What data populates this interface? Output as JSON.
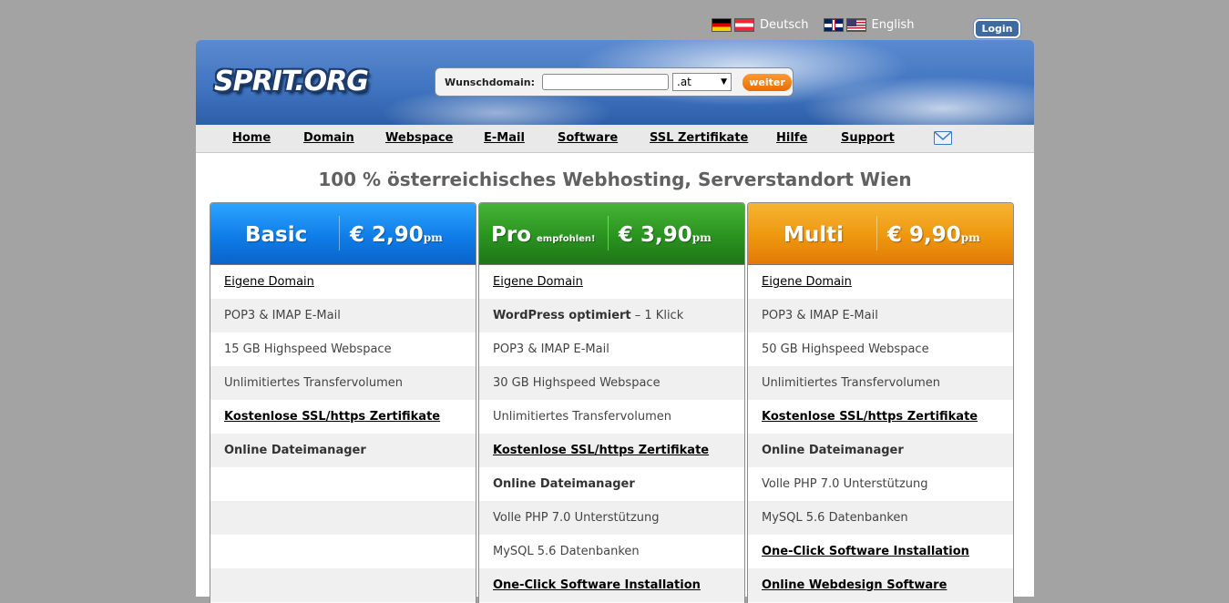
{
  "languages": [
    {
      "label": "Deutsch"
    },
    {
      "label": "English"
    }
  ],
  "login_label": "Login",
  "header": {
    "logo": "SPRIT.ORG",
    "search_label": "Wunschdomain:",
    "search_value": "",
    "tld_selected": ".at",
    "submit_label": "weiter"
  },
  "nav": {
    "items": [
      "Home",
      "Domain",
      "Webspace",
      "E-Mail",
      "Software",
      "SSL Zertifikate",
      "Hilfe",
      "Support"
    ]
  },
  "headline": "100 % österreichisches Webhosting, Serverstandort Wien",
  "plans": [
    {
      "name": "Basic",
      "tag": "",
      "price": "€ 2,90",
      "price_unit": "pm",
      "color": "#0f7de8",
      "features": [
        {
          "text": "Eigene Domain",
          "style": "link"
        },
        {
          "text": "POP3 & IMAP E-Mail",
          "style": "plain"
        },
        {
          "text": "15 GB Highspeed Webspace",
          "style": "plain"
        },
        {
          "text": "Unlimitiertes Transfervolumen",
          "style": "plain"
        },
        {
          "text": "Kostenlose SSL/https Zertifikate",
          "style": "strong-link"
        },
        {
          "text": "Online Dateimanager",
          "style": "strong"
        },
        {
          "text": "",
          "style": "plain"
        },
        {
          "text": "",
          "style": "plain"
        },
        {
          "text": "",
          "style": "plain"
        },
        {
          "text": "",
          "style": "plain"
        }
      ]
    },
    {
      "name": "Pro",
      "tag": "empfohlen!",
      "price": "€ 3,90",
      "price_unit": "pm",
      "color": "#2a9320",
      "features": [
        {
          "text": "Eigene Domain",
          "style": "link"
        },
        {
          "text": "WordPress optimiert",
          "suffix": " – 1 Klick",
          "style": "strong"
        },
        {
          "text": "POP3 & IMAP E-Mail",
          "style": "plain"
        },
        {
          "text": "30 GB Highspeed Webspace",
          "style": "plain"
        },
        {
          "text": "Unlimitiertes Transfervolumen",
          "style": "plain"
        },
        {
          "text": "Kostenlose SSL/https Zertifikate",
          "style": "strong-link"
        },
        {
          "text": "Online Dateimanager",
          "style": "strong"
        },
        {
          "text": "Volle PHP 7.0 Unterstützung",
          "style": "plain"
        },
        {
          "text": "MySQL 5.6 Datenbanken",
          "style": "plain"
        },
        {
          "text": "One-Click Software Installation",
          "style": "strong-link"
        }
      ]
    },
    {
      "name": "Multi",
      "tag": "",
      "price": "€ 9,90",
      "price_unit": "pm",
      "color": "#ee970f",
      "features": [
        {
          "text": "Eigene Domain",
          "style": "link"
        },
        {
          "text": "POP3 & IMAP E-Mail",
          "style": "plain"
        },
        {
          "text": "50 GB Highspeed Webspace",
          "style": "plain"
        },
        {
          "text": "Unlimitiertes Transfervolumen",
          "style": "plain"
        },
        {
          "text": "Kostenlose SSL/https Zertifikate",
          "style": "strong-link"
        },
        {
          "text": "Online Dateimanager",
          "style": "strong"
        },
        {
          "text": "Volle PHP 7.0 Unterstützung",
          "style": "plain"
        },
        {
          "text": "MySQL 5.6 Datenbanken",
          "style": "plain"
        },
        {
          "text": "One-Click Software Installation",
          "style": "strong-link"
        },
        {
          "text": "Online Webdesign Software",
          "style": "strong-link"
        }
      ]
    }
  ]
}
